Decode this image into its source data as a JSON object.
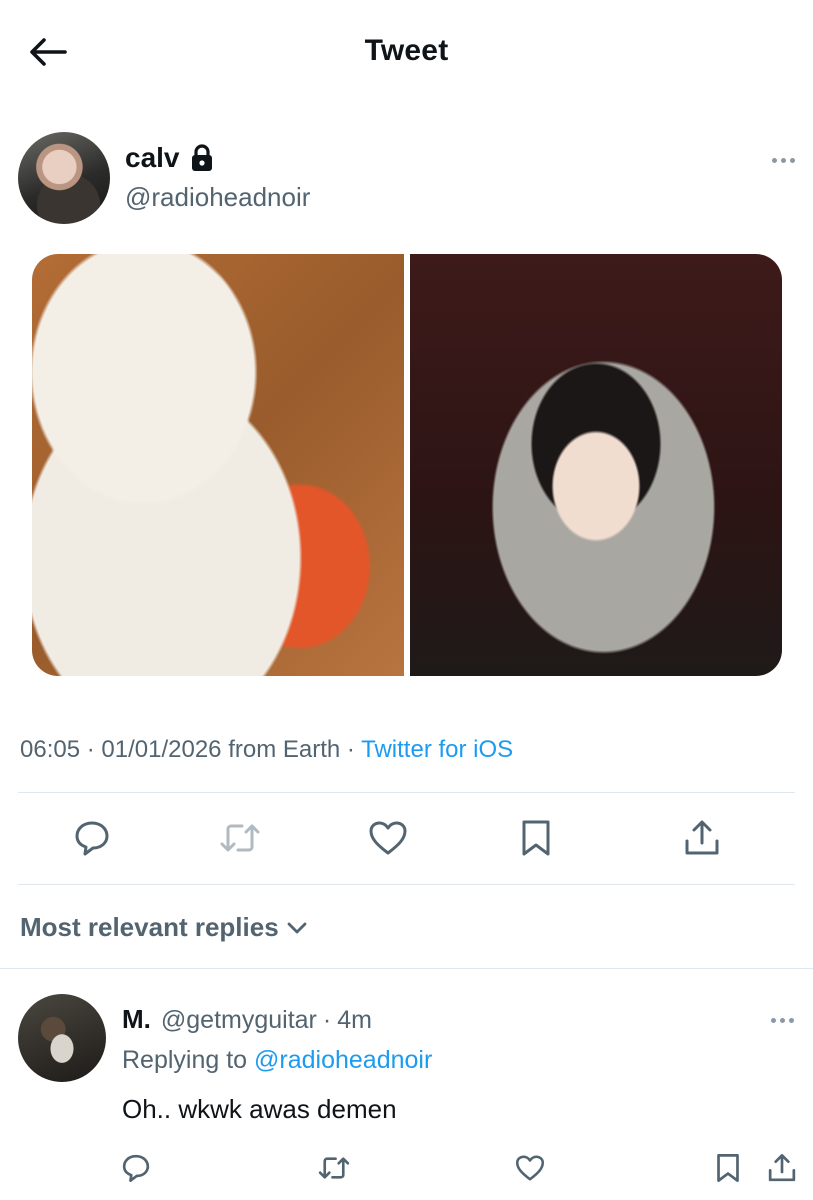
{
  "header": {
    "title": "Tweet"
  },
  "tweet": {
    "author": {
      "name": "calv",
      "handle": "@radioheadnoir"
    },
    "media": [
      {
        "kind": "photo",
        "subject": "food"
      },
      {
        "kind": "photo",
        "subject": "person"
      }
    ],
    "meta": {
      "time": "06:05",
      "sep1": "·",
      "date": "01/01/2026",
      "location": "from Earth",
      "sep2": "·",
      "source": "Twitter for iOS"
    }
  },
  "replies": {
    "sort_label": "Most relevant replies",
    "items": [
      {
        "name": "M.",
        "handle": "@getmyguitar",
        "sep": "·",
        "time": "4m",
        "replying_prefix": "Replying to",
        "replying_to": "@radioheadnoir",
        "text": "Oh.. wkwk awas demen"
      }
    ]
  },
  "colors": {
    "accent": "#1d9bf0",
    "secondary_text": "#536471",
    "icon": "#536471",
    "divider": "#e1e8ed"
  },
  "icons": [
    "back-arrow-icon",
    "lock-icon",
    "more-icon",
    "reply-icon",
    "retweet-icon",
    "like-icon",
    "bookmark-icon",
    "share-icon",
    "chevron-down-icon"
  ]
}
